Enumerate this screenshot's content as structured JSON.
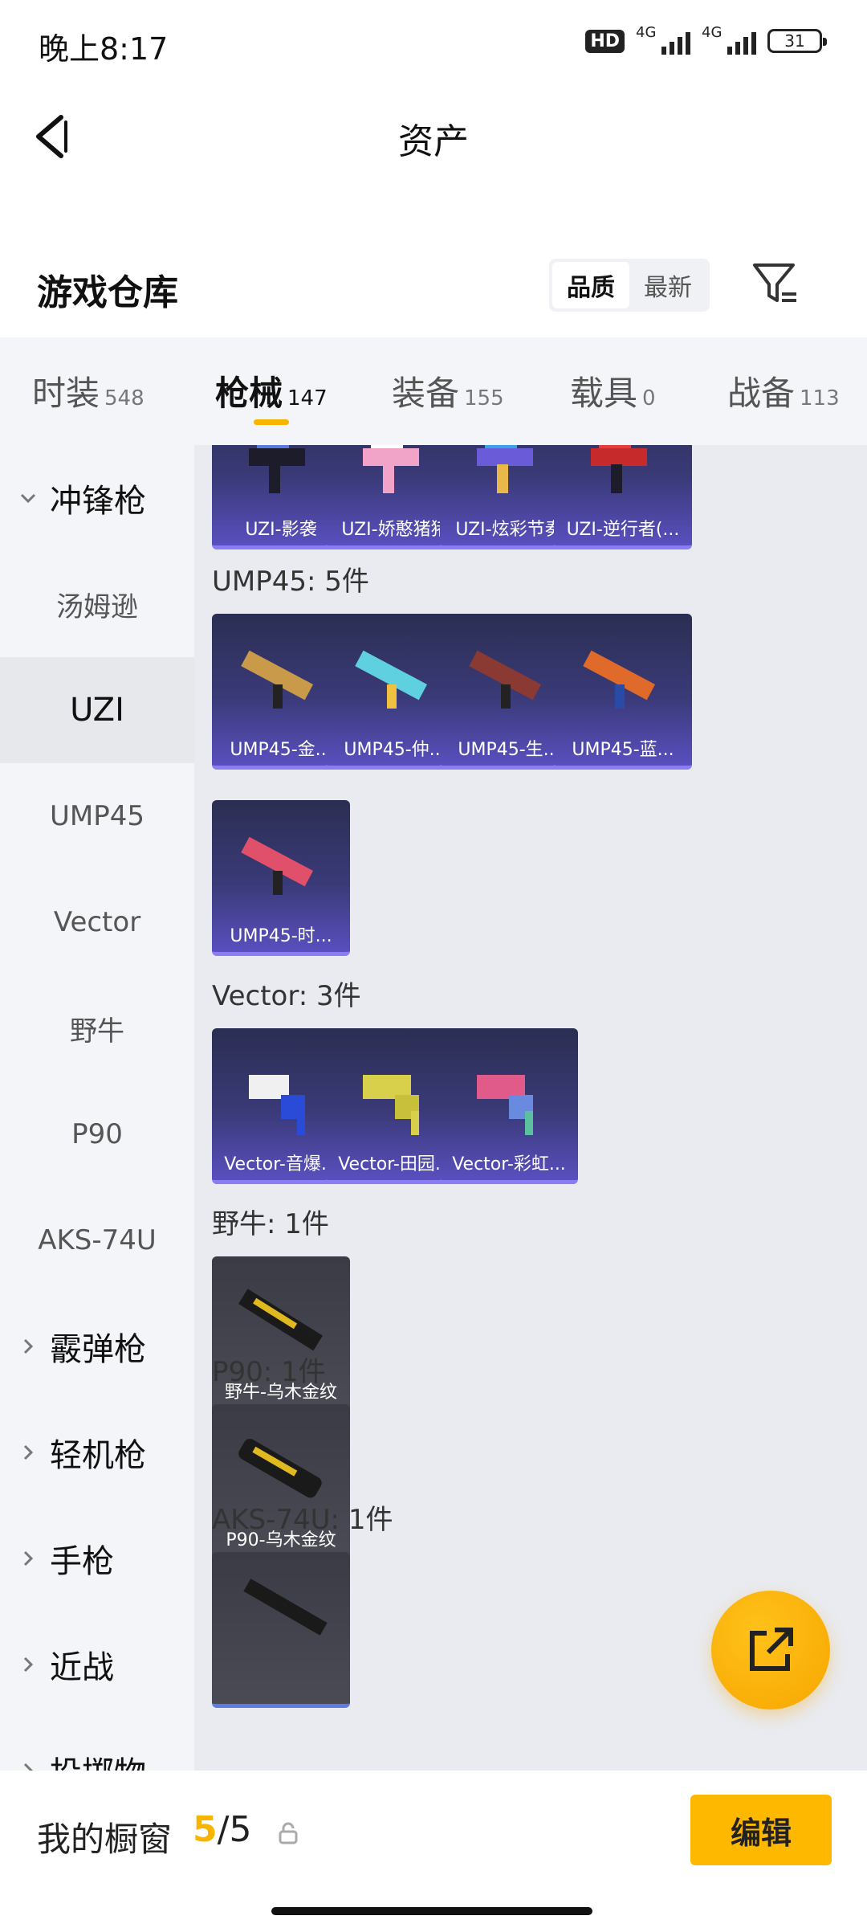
{
  "status_bar": {
    "time": "晚上8:17",
    "hd": "HD",
    "net1": "4G",
    "net2": "4G",
    "battery": "31"
  },
  "header": {
    "title": "资产"
  },
  "section": {
    "title": "游戏仓库",
    "sort": [
      "品质",
      "最新"
    ],
    "sort_active": "品质"
  },
  "tabs": [
    {
      "label": "时装",
      "count": "548"
    },
    {
      "label": "枪械",
      "count": "147"
    },
    {
      "label": "装备",
      "count": "155"
    },
    {
      "label": "载具",
      "count": "0"
    },
    {
      "label": "战备",
      "count": "113"
    }
  ],
  "active_tab": "枪械",
  "sidebar": {
    "group_open": "冲锋枪",
    "items": [
      "汤姆逊",
      "UZI",
      "UMP45",
      "Vector",
      "野牛",
      "P90",
      "AKS-74U"
    ],
    "selected": "UZI",
    "groups": [
      "霰弹枪",
      "轻机枪",
      "手枪",
      "近战",
      "投掷物"
    ]
  },
  "content": {
    "uzi_cards": [
      "UZI-影袭",
      "UZI-娇憨猪猪",
      "UZI-炫彩节奏",
      "UZI-逆行者(..."
    ],
    "ump_heading": "UMP45: 5件",
    "ump_cards": [
      "UMP45-金...",
      "UMP45-仲...",
      "UMP45-生...",
      "UMP45-蓝...",
      "UMP45-时..."
    ],
    "vector_heading": "Vector: 3件",
    "vector_cards": [
      "Vector-音爆...",
      "Vector-田园...",
      "Vector-彩虹..."
    ],
    "bison_heading": "野牛: 1件",
    "bison_cards": [
      "野牛-乌木金纹"
    ],
    "p90_heading": "P90: 1件",
    "p90_cards": [
      "P90-乌木金纹"
    ],
    "aks_heading": "AKS-74U: 1件"
  },
  "bottom": {
    "shelf_label": "我的橱窗",
    "shelf_current": "5",
    "shelf_sep": "/",
    "shelf_total": "5",
    "edit": "编辑"
  },
  "colors": {
    "accent": "#f7b500",
    "purple_card": "#3a3a78",
    "gray_card": "#3a3b44"
  }
}
